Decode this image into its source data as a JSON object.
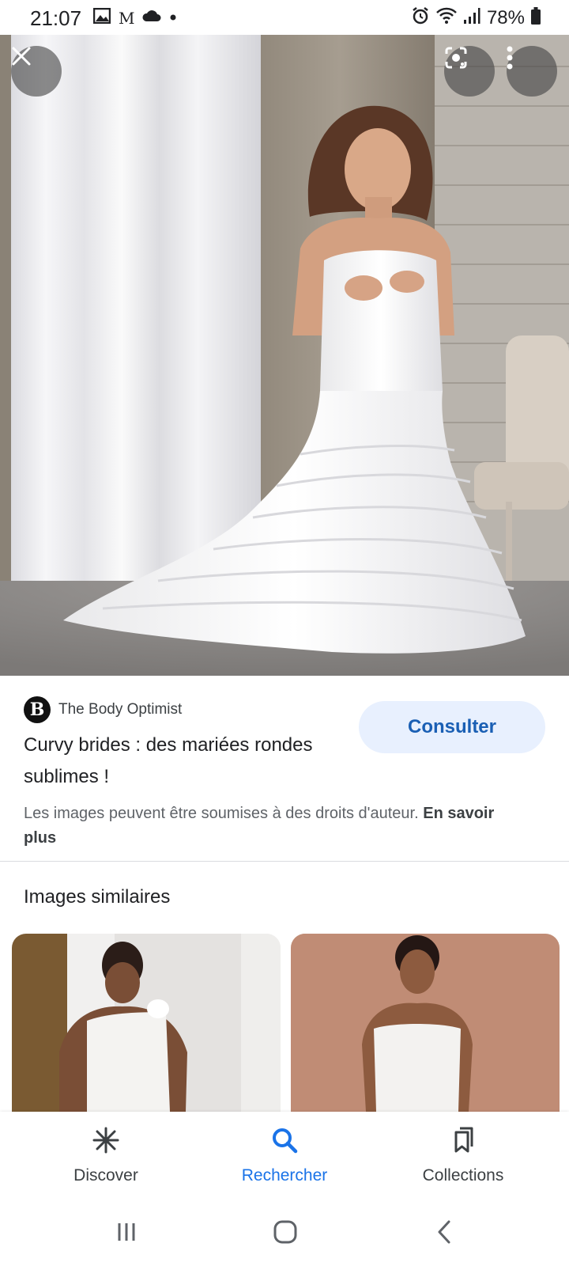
{
  "status_bar": {
    "time": "21:07",
    "battery": "78%",
    "left_icons": [
      "gallery-icon",
      "gmail-icon",
      "cloud-icon",
      "dot-icon"
    ],
    "right_icons": [
      "alarm-icon",
      "wifi-icon",
      "signal-icon",
      "battery-icon"
    ]
  },
  "viewer": {
    "close_icon": "close-icon",
    "lens_icon": "lens-icon",
    "more_icon": "more-vert-icon"
  },
  "result": {
    "source_logo": "B",
    "source_name": "The Body Optimist",
    "title": "Curvy brides : des mariées rondes sublimes !",
    "visit_button": "Consulter",
    "copyright_text": "Les images peuvent être soumises à des droits d'auteur.",
    "learn_more": "En savoir plus"
  },
  "similar": {
    "heading": "Images similaires"
  },
  "bottom_nav": {
    "items": [
      {
        "label": "Discover",
        "icon": "asterisk-icon",
        "active": false
      },
      {
        "label": "Rechercher",
        "icon": "search-icon",
        "active": true
      },
      {
        "label": "Collections",
        "icon": "bookmarks-icon",
        "active": false
      }
    ],
    "active_color": "#1a73e8"
  },
  "system_nav": {
    "recent_icon": "recent-apps-icon",
    "home_icon": "home-icon",
    "back_icon": "back-icon"
  },
  "colors": {
    "accent": "#1a73e8",
    "button_bg": "#e8f0fe",
    "button_text": "#1a5fb4"
  }
}
